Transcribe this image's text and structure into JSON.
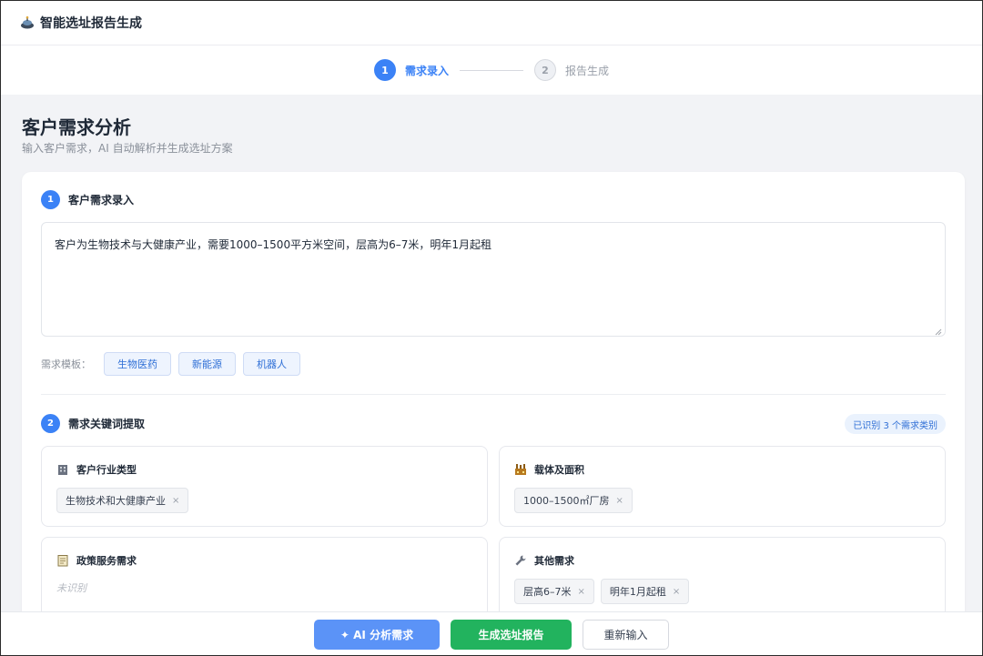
{
  "header": {
    "title": "智能选址报告生成",
    "logo_icon": "tech-bot-icon"
  },
  "stepper": {
    "steps": [
      {
        "num": "1",
        "label": "需求录入",
        "state": "active"
      },
      {
        "num": "2",
        "label": "报告生成",
        "state": "inactive"
      }
    ]
  },
  "page": {
    "title": "客户需求分析",
    "subtitle": "输入客户需求，AI 自动解析并生成选址方案"
  },
  "section1": {
    "num": "1",
    "title": "客户需求录入",
    "input_value": "客户为生物技术与大健康产业，需要1000–1500平方米空间，层高为6–7米，明年1月起租",
    "template_label": "需求模板：",
    "templates": [
      "生物医药",
      "新能源",
      "机器人"
    ]
  },
  "section2": {
    "num": "2",
    "title": "需求关键词提取",
    "badge": "已识别 3 个需求类别",
    "categories": [
      {
        "icon": "building-icon",
        "title": "客户行业类型",
        "tags": [
          "生物技术和大健康产业"
        ]
      },
      {
        "icon": "factory-icon",
        "title": "载体及面积",
        "tags": [
          "1000–1500㎡厂房"
        ]
      },
      {
        "icon": "notepad-icon",
        "title": "政策服务需求",
        "tags": [],
        "empty_text": "未识别"
      },
      {
        "icon": "wrench-icon",
        "title": "其他需求",
        "tags": [
          "层高6–7米",
          "明年1月起租"
        ]
      }
    ],
    "tag_remove_glyph": "×"
  },
  "actions": {
    "ai_analyze": "✦ AI 分析需求",
    "generate": "生成选址报告",
    "reset": "重新输入"
  },
  "colors": {
    "primary": "#3b82f6",
    "success": "#22b35e",
    "ai_button": "#5b93f7",
    "background": "#f2f3f6"
  }
}
